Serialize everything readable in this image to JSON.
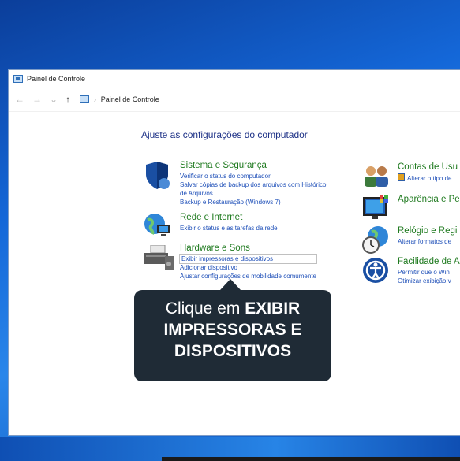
{
  "window": {
    "title": "Painel de Controle"
  },
  "address": {
    "back": "←",
    "forward": "→",
    "dropdown": "⌄",
    "up": "↑",
    "separator": "›",
    "path": "Painel de Controle"
  },
  "heading": "Ajuste as configurações do computador",
  "categories": [
    {
      "title": "Sistema e Segurança",
      "links": [
        "Verificar o status do computador",
        "Salvar cópias de backup dos arquivos com Histórico",
        "de Arquivos",
        "Backup e Restauração (Windows 7)"
      ]
    },
    {
      "title": "Rede e Internet",
      "links": [
        "Exibir o status e as tarefas da rede"
      ]
    },
    {
      "title": "Hardware e Sons",
      "links": [
        "Exibir impressoras e dispositivos",
        "Adicionar dispositivo",
        "Ajustar configurações de mobilidade comumente"
      ]
    },
    {
      "title": "Contas de Usu",
      "links": [
        "Alterar o tipo de"
      ]
    },
    {
      "title": "Aparência e Pe",
      "links": []
    },
    {
      "title": "Relógio e Regi",
      "links": [
        "Alterar formatos de"
      ]
    },
    {
      "title": "Facilidade de A",
      "links": [
        "Permitir que o Win",
        "Otimizar exibição v"
      ]
    }
  ],
  "tooltip": {
    "line1_prefix": "Clique em ",
    "line1_bold": "EXIBIR",
    "line2": "IMPRESSORAS E",
    "line3": "DISPOSITIVOS"
  },
  "colors": {
    "accent": "#1f7a1f",
    "link": "#1e4fb8",
    "tooltip_bg": "#1f2b36"
  }
}
